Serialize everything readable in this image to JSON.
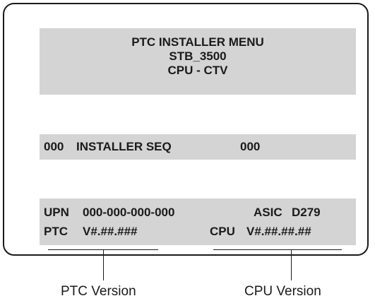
{
  "menu": {
    "title_lines": [
      "PTC  INSTALLER  MENU",
      "STB_3500",
      "CPU - CTV"
    ]
  },
  "installer_seq": {
    "left_value": "000",
    "label": "INSTALLER SEQ",
    "right_value": "000"
  },
  "info": {
    "upn_label": "UPN",
    "upn_value": "000-000-000-000",
    "asic_label": "ASIC",
    "asic_value": "D279",
    "ptc_label": "PTC",
    "ptc_value": "V#.##.###",
    "cpu_label": "CPU",
    "cpu_value": "V#.##.##.##"
  },
  "callouts": {
    "ptc": "PTC Version",
    "cpu": "CPU Version"
  }
}
